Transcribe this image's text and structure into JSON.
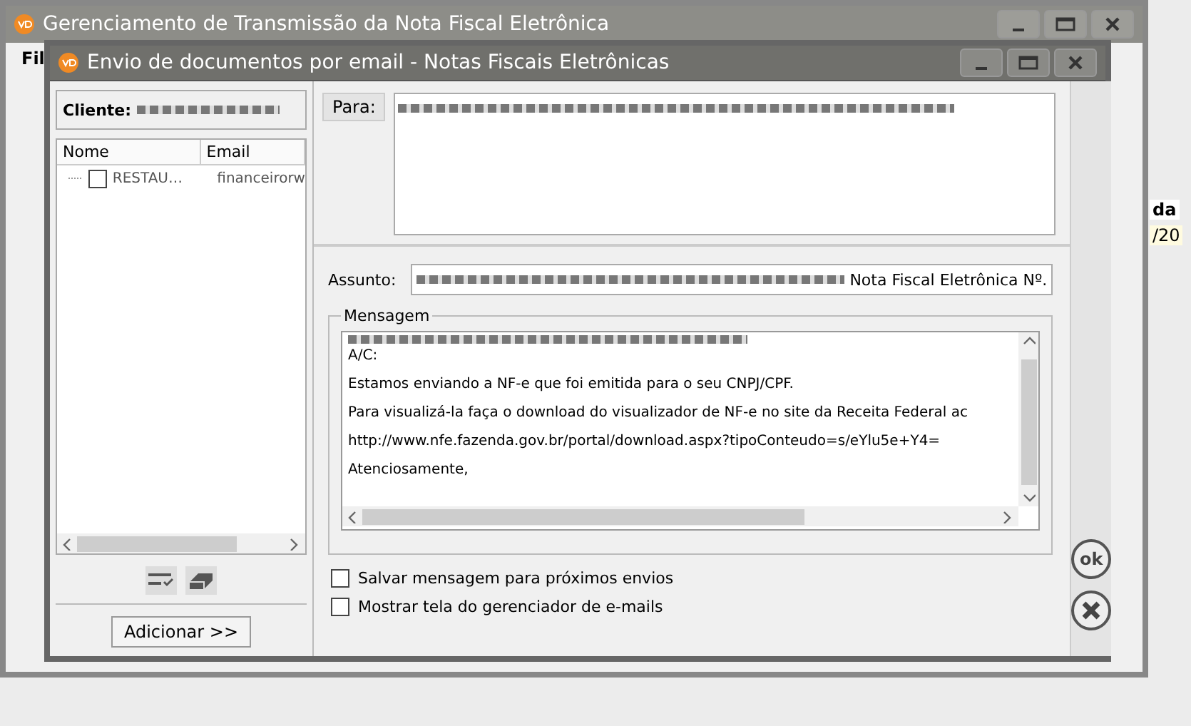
{
  "back_window": {
    "title": "Gerenciamento de Transmissão da Nota Fiscal Eletrônica",
    "fragments": [
      "Fil",
      "da",
      "/20"
    ]
  },
  "window": {
    "title": "Envio de documentos por email - Notas Fiscais Eletrônicas"
  },
  "client": {
    "label": "Cliente:"
  },
  "contacts": {
    "columns": [
      "Nome",
      "Email"
    ],
    "rows": [
      {
        "name": "RESTAU…",
        "email": "financeirorw",
        "checked": false
      }
    ]
  },
  "add_button": "Adicionar >>",
  "to": {
    "label": "Para:"
  },
  "subject": {
    "label": "Assunto:",
    "value": "Nota Fiscal Eletrônica Nº."
  },
  "message": {
    "label": "Mensagem",
    "lines": [
      "A/C:",
      "Estamos enviando a NF-e que foi emitida para o seu CNPJ/CPF.",
      "Para visualizá-la faça o download do visualizador de NF-e no site da Receita Federal ac",
      "http://www.nfe.fazenda.gov.br/portal/download.aspx?tipoConteudo=s/eYlu5e+Y4=",
      "Atenciosamente,"
    ]
  },
  "options": [
    {
      "label": "Salvar mensagem para próximos envios",
      "checked": false
    },
    {
      "label": "Mostrar tela do gerenciador de e-mails",
      "checked": false
    }
  ],
  "actions": [
    {
      "kind": "ok",
      "label": "ok"
    },
    {
      "kind": "cancel"
    }
  ]
}
